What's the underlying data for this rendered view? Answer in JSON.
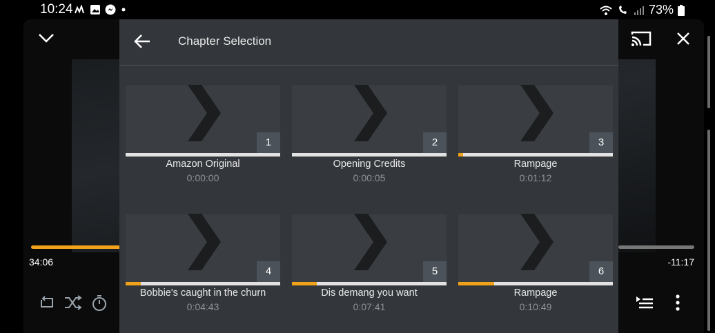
{
  "status": {
    "time": "10:24",
    "battery": "73%"
  },
  "player": {
    "elapsed": "34:06",
    "remaining": "-11:17",
    "progress_fraction": 0.75
  },
  "panel": {
    "title": "Chapter Selection"
  },
  "chapters": [
    {
      "number": "1",
      "title": "Amazon Original",
      "time": "0:00:00",
      "progress": 0.0
    },
    {
      "number": "2",
      "title": "Opening Credits",
      "time": "0:00:05",
      "progress": 0.0
    },
    {
      "number": "3",
      "title": "Rampage",
      "time": "0:01:12",
      "progress": 0.03
    },
    {
      "number": "4",
      "title": "Bobbie's caught in the churn",
      "time": "0:04:43",
      "progress": 0.1
    },
    {
      "number": "5",
      "title": "Dis demang you want",
      "time": "0:07:41",
      "progress": 0.16
    },
    {
      "number": "6",
      "title": "Rampage",
      "time": "0:10:49",
      "progress": 0.23
    }
  ],
  "colors": {
    "accent": "#f0a31a",
    "panel": "#33373b"
  },
  "icons": [
    "collapse-chevron-icon",
    "cast-icon",
    "close-icon",
    "back-arrow-icon",
    "repeat-icon",
    "shuffle-icon",
    "timer-icon",
    "queue-icon",
    "more-icon"
  ]
}
